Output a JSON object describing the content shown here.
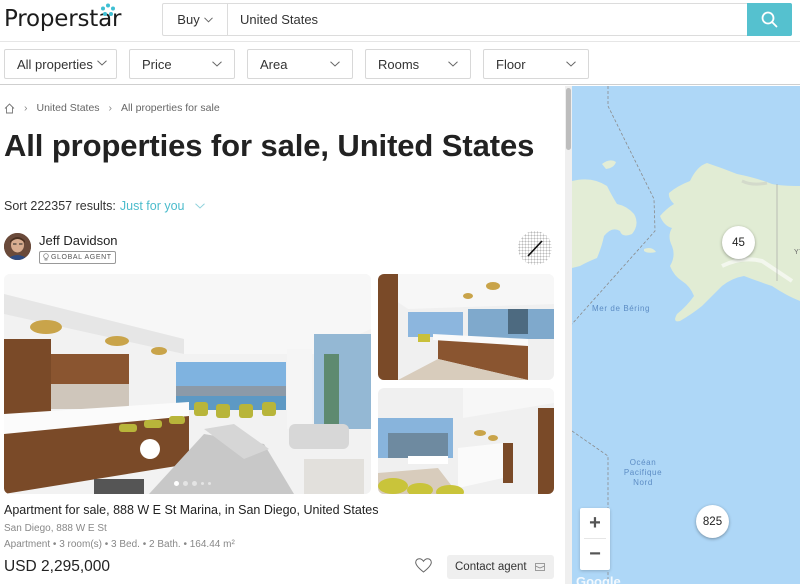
{
  "header": {
    "logo_text": "Properstar",
    "search_type": "Buy",
    "search_value": "United States",
    "search_icon": "search-icon"
  },
  "filters": [
    {
      "label": "All properties"
    },
    {
      "label": "Price"
    },
    {
      "label": "Area"
    },
    {
      "label": "Rooms"
    },
    {
      "label": "Floor"
    }
  ],
  "breadcrumb": {
    "home_icon": "home-icon",
    "items": [
      "United States",
      "All properties for sale"
    ]
  },
  "page_title": "All properties for sale, United States",
  "sort": {
    "prefix": "Sort 222357 results:",
    "value": "Just for you"
  },
  "agent": {
    "name": "Jeff Davidson",
    "badge": "GLOBAL AGENT"
  },
  "listing": {
    "title": "Apartment for sale, 888 W E St Marina, in San Diego, United States",
    "address": "San Diego, 888 W E St",
    "specs": "Apartment • 3 room(s) • 3 Bed. • 2 Bath. • 164.44 m²",
    "price": "USD 2,295,000",
    "contact_label": "Contact agent",
    "photo_count_dots": 5,
    "active_photo": 1
  },
  "map": {
    "labels": {
      "bering": "Mer de Béring",
      "pacific": "Océan\nPacifique\nNord",
      "yt": "YT"
    },
    "clusters": [
      {
        "count": "45"
      },
      {
        "count": "825"
      }
    ],
    "zoom_in": "+",
    "zoom_out": "−",
    "attribution": "Google"
  },
  "colors": {
    "accent": "#55c1cf",
    "link": "#4cbccc",
    "map_water": "#aed7f7",
    "map_land": "#e4efd9"
  }
}
